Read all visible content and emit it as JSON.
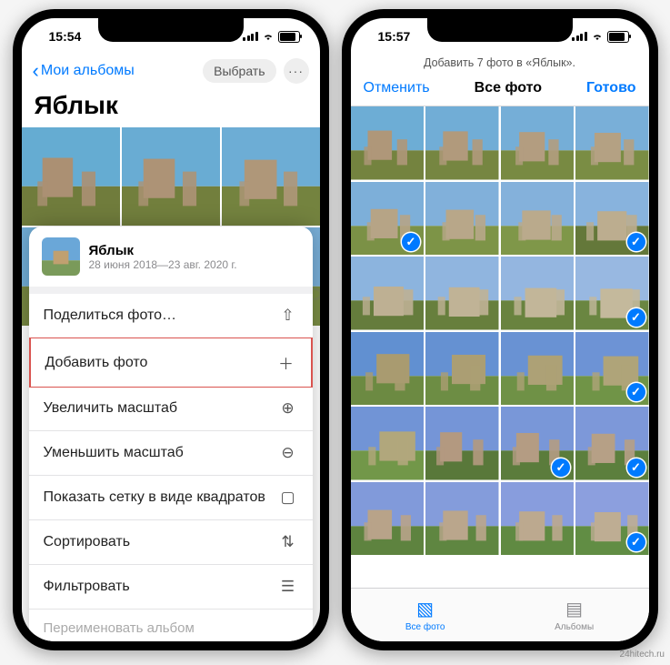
{
  "watermark": "24hitech.ru",
  "faint_overlay": "ЯБЛЫК",
  "left": {
    "time": "15:54",
    "back_label": "Мои альбомы",
    "select_label": "Выбрать",
    "more_label": "···",
    "album_title": "Яблык",
    "sheet": {
      "title": "Яблык",
      "subtitle": "28 июня 2018—23 авг. 2020 г.",
      "items": [
        {
          "label": "Поделиться фото…",
          "icon": "share-icon",
          "glyph": "⇧",
          "hl": false
        },
        {
          "label": "Добавить фото",
          "icon": "plus-icon",
          "glyph": "＋",
          "hl": true
        },
        {
          "label": "Увеличить масштаб",
          "icon": "zoom-in-icon",
          "glyph": "⊕",
          "hl": false
        },
        {
          "label": "Уменьшить масштаб",
          "icon": "zoom-out-icon",
          "glyph": "⊖",
          "hl": false
        },
        {
          "label": "Показать сетку в виде квадратов",
          "icon": "grid-icon",
          "glyph": "▢",
          "hl": false
        },
        {
          "label": "Сортировать",
          "icon": "sort-icon",
          "glyph": "⇅",
          "hl": false
        },
        {
          "label": "Фильтровать",
          "icon": "filter-icon",
          "glyph": "☰",
          "hl": false
        }
      ],
      "rename_label": "Переименовать альбом"
    }
  },
  "right": {
    "time": "15:57",
    "title_line": "Добавить 7 фото в «Яблык».",
    "cancel": "Отменить",
    "center": "Все фото",
    "done": "Готово",
    "selected_indices": [
      4,
      7,
      11,
      15,
      18,
      19,
      23
    ],
    "tabs": {
      "all_photos": "Все фото",
      "albums": "Альбомы"
    }
  }
}
